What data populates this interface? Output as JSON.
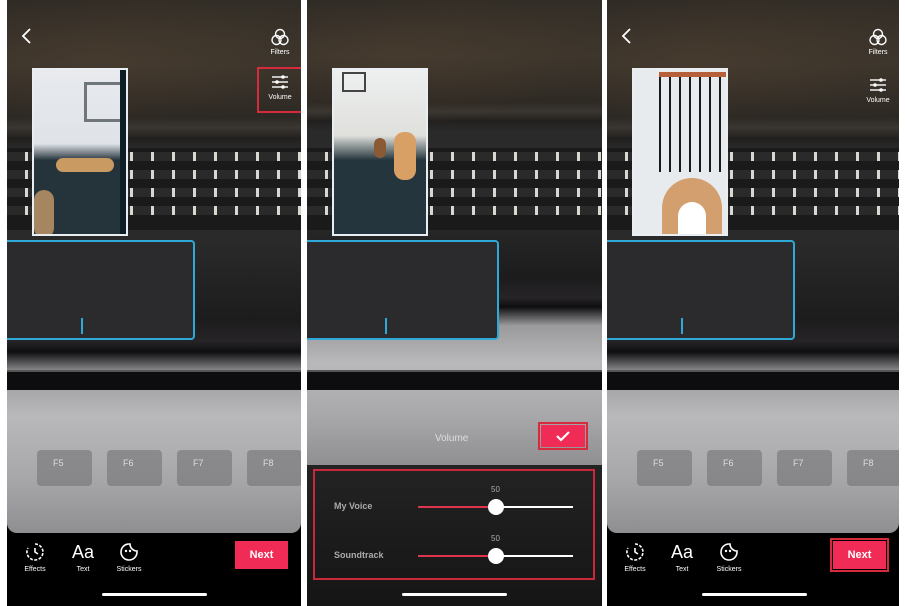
{
  "panels": [
    {
      "id": "edit-screen",
      "back_icon": "chevron-left-icon",
      "side_buttons": [
        {
          "label": "Filters",
          "icon": "filters-icon",
          "highlighted": false
        },
        {
          "label": "Volume",
          "icon": "sliders-icon",
          "highlighted": true
        }
      ],
      "thumbnail": "Dog lying on floor",
      "keyboard_fkeys": [
        "F5",
        "F6",
        "F7",
        "F8"
      ],
      "toolbar": {
        "tools": [
          {
            "label": "Effects",
            "icon": "effects-timer-icon"
          },
          {
            "label": "Text",
            "icon": "Aa"
          },
          {
            "label": "Stickers",
            "icon": "sticker-icon"
          }
        ],
        "next_label": "Next",
        "next_highlighted": false
      }
    },
    {
      "id": "volume-screen",
      "thumbnail": "Two dogs running in hallway",
      "volume_title": "Volume",
      "confirm_icon": "checkmark-icon",
      "sliders": [
        {
          "label": "My Voice",
          "value": 50,
          "max": 100
        },
        {
          "label": "Soundtrack",
          "value": 50,
          "max": 100
        }
      ]
    },
    {
      "id": "edit-screen-after",
      "back_icon": "chevron-left-icon",
      "side_buttons": [
        {
          "label": "Filters",
          "icon": "filters-icon",
          "highlighted": false
        },
        {
          "label": "Volume",
          "icon": "sliders-icon",
          "highlighted": false
        }
      ],
      "thumbnail": "Dog at stair railing",
      "keyboard_fkeys": [
        "F5",
        "F6",
        "F7",
        "F8"
      ],
      "toolbar": {
        "tools": [
          {
            "label": "Effects",
            "icon": "effects-timer-icon"
          },
          {
            "label": "Text",
            "icon": "Aa"
          },
          {
            "label": "Stickers",
            "icon": "sticker-icon"
          }
        ],
        "next_label": "Next",
        "next_highlighted": true
      }
    }
  ],
  "colors": {
    "accent": "#f02b55",
    "highlight_outline": "#d62b3c",
    "trackpad_outline": "#2fa9d8"
  }
}
